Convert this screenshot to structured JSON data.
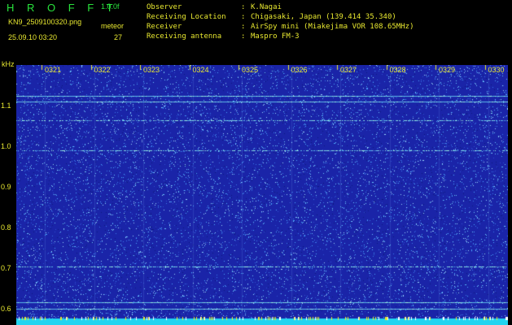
{
  "header": {
    "app_title": "H R O F F T",
    "app_version": "1.0.0f",
    "file_name": "KN9_2509100320.png",
    "meteor_label": "meteor",
    "datetime": "25.09.10 03:20",
    "meteor_count": "27",
    "info": [
      {
        "label": "Observer",
        "value": "K.Nagai"
      },
      {
        "label": "Receiving Location",
        "value": "Chigasaki, Japan (139.414 35.340)"
      },
      {
        "label": "Receiver",
        "value": "AirSpy mini (Miakejima VOR 108.65MHz)"
      },
      {
        "label": "Receiving antenna",
        "value": "Maspro FM-3"
      }
    ]
  },
  "spectrogram": {
    "y_unit": "kHz",
    "y_ticks": [
      "1.1",
      "1.0",
      "0.9",
      "0.8",
      "0.7",
      "0.6"
    ],
    "y_range": [
      0.58,
      1.14
    ],
    "time_ticks": [
      "0321",
      "0322",
      "0323",
      "0324",
      "0325",
      "0326",
      "0327",
      "0328",
      "0329",
      "0330"
    ],
    "carrier_lines_khz": [
      1.125,
      1.11,
      1.065,
      0.99,
      0.705,
      0.617,
      0.6
    ],
    "colors": {
      "background": "#1a24a8",
      "noise": "#4aa8ff",
      "line": "#9cf0e0",
      "bottom_band": "#22d4f0",
      "text": "#e8e830"
    }
  }
}
